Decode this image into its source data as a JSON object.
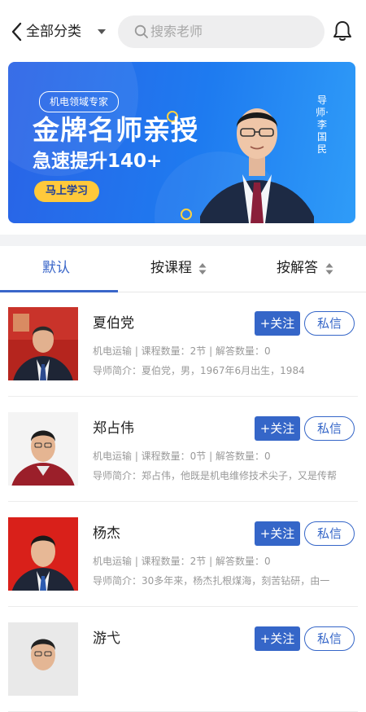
{
  "header": {
    "category_label": "全部分类",
    "search_placeholder": "搜索老师"
  },
  "banner": {
    "tag": "机电领域专家",
    "headline": "金牌名师亲授",
    "subline": "急速提升140+",
    "cta": "马上学习",
    "mentor_caption": "导师·李国民"
  },
  "tabs": [
    {
      "label": "默认",
      "active": true
    },
    {
      "label": "按课程",
      "active": false
    },
    {
      "label": "按解答",
      "active": false
    }
  ],
  "teachers": [
    {
      "name": "夏伯党",
      "meta": "机电运输 | 课程数量：2节 | 解答数量：0",
      "bio": "导师简介：夏伯党，男，1967年6月出生，1984",
      "follow": "+关注",
      "message": "私信"
    },
    {
      "name": "郑占伟",
      "meta": "机电运输 | 课程数量：0节 | 解答数量：0",
      "bio": "导师简介：郑占伟，他既是机电维修技术尖子，又是传帮",
      "follow": "+关注",
      "message": "私信"
    },
    {
      "name": "杨杰",
      "meta": "机电运输 | 课程数量：2节 | 解答数量：0",
      "bio": "导师简介：30多年来，杨杰扎根煤海，刻苦钻研，由一",
      "follow": "+关注",
      "message": "私信"
    },
    {
      "name": "游弋",
      "meta": "",
      "bio": "",
      "follow": "+关注",
      "message": "私信"
    }
  ],
  "colors": {
    "accent": "#3566c8",
    "banner_start": "#2a63e6",
    "banner_end": "#2f9cf8",
    "cta": "#ffc93b"
  }
}
